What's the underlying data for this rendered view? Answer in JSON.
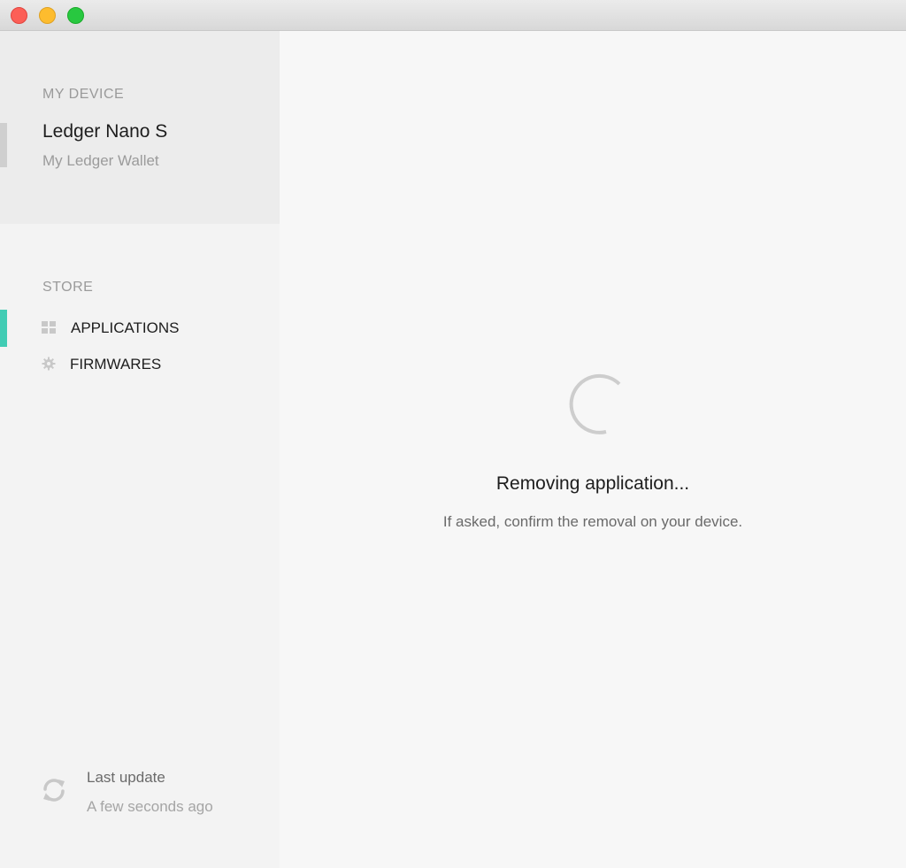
{
  "sidebar": {
    "device_section_label": "MY DEVICE",
    "device_name": "Ledger Nano S",
    "device_subtitle": "My Ledger Wallet",
    "store_section_label": "STORE",
    "nav_items": [
      {
        "label": "APPLICATIONS",
        "icon": "grid-icon",
        "active": true
      },
      {
        "label": "FIRMWARES",
        "icon": "gear-icon",
        "active": false
      }
    ],
    "last_update_label": "Last update",
    "last_update_time": "A few seconds ago"
  },
  "main": {
    "status_title": "Removing application...",
    "status_message": "If asked, confirm the removal on your device."
  },
  "colors": {
    "accent": "#41ccb4",
    "close": "#fc5f57",
    "minimize": "#fdbc2e",
    "maximize": "#28c840"
  }
}
